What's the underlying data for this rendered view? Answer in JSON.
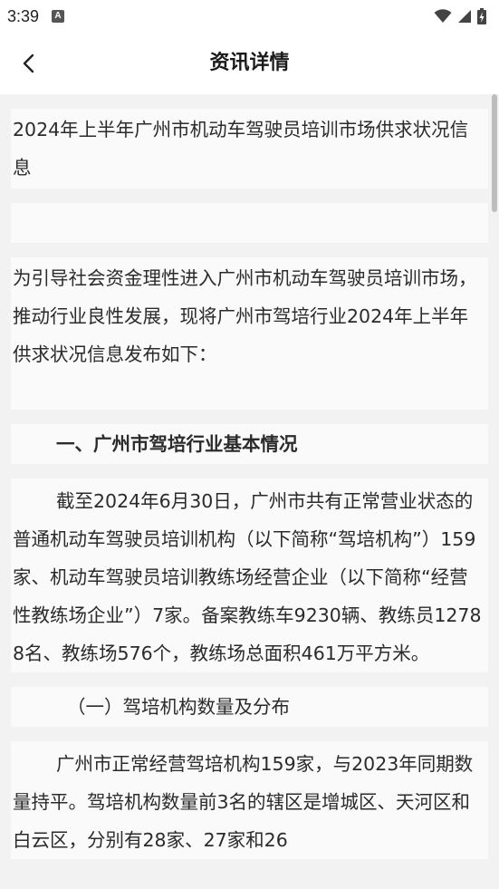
{
  "status_bar": {
    "time": "3:39",
    "notification_icon": "A"
  },
  "header": {
    "title": "资讯详情",
    "back_icon": "chevron-left-icon"
  },
  "article": {
    "title": "2024年上半年广州市机动车驾驶员培训市场供求状况信息",
    "intro": " 为引导社会资金理性进入广州市机动车驾驶员培训市场，推动行业良性发展，现将广州市驾培行业2024年上半年供求状况信息发布如下：",
    "section1_heading": "一、广州市驾培行业基本情况",
    "section1_para": "截至2024年6月30日，广州市共有正常营业状态的普通机动车驾驶员培训机构（以下简称“驾培机构”）159家、机动车驾驶员培训教练场经营企业（以下简称“经营性教练场企业”）7家。备案教练车9230辆、教练员12788名、教练场576个，教练场总面积461万平方米。",
    "subsection1_heading": "（一）驾培机构数量及分布",
    "subsection1_para": "广州市正常经营驾培机构159家，与2023年同期数量持平。驾培机构数量前3名的辖区是增城区、天河区和白云区，分别有28家、27家和26"
  }
}
